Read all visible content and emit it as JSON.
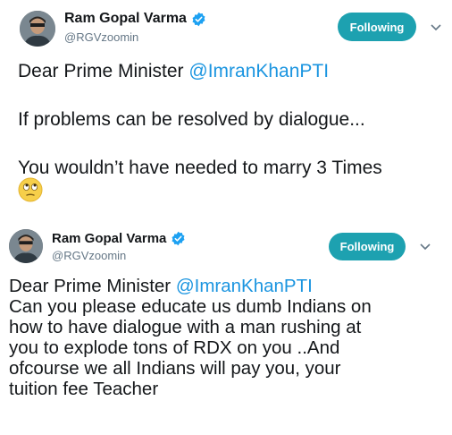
{
  "tweets": [
    {
      "author": {
        "name": "Ram Gopal Varma",
        "handle": "@RGVzoomin"
      },
      "follow_label": "Following",
      "text_prefix": "Dear Prime Minister ",
      "mention": "@ImranKhanPTI",
      "line2": "If problems can be  resolved by dialogue...",
      "line3": "You wouldn’t have needed to marry 3 Times",
      "emoji_icon": "face-with-rolling-eyes-icon"
    },
    {
      "author": {
        "name": "Ram Gopal Varma",
        "handle": "@RGVzoomin"
      },
      "follow_label": "Following",
      "text_prefix": "Dear Prime Minister ",
      "mention": "@ImranKhanPTI",
      "lines": [
        "Can you please educate us dumb Indians on",
        "how to have dialogue with a man rushing at",
        "you to explode tons of RDX on you ..And",
        "ofcourse we all Indians will pay you, your",
        "tuition fee Teacher"
      ]
    }
  ],
  "colors": {
    "accent_button": "#1da1b0",
    "mention": "#1b95e0",
    "verified": "#1da1f2",
    "handle": "#657786"
  }
}
